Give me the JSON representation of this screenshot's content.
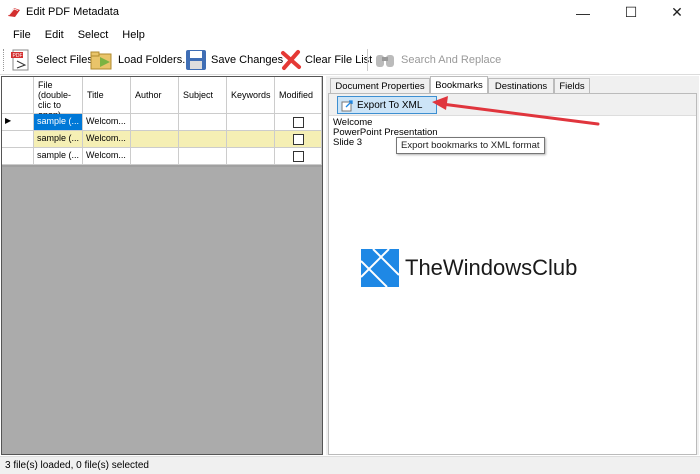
{
  "window": {
    "title": "Edit PDF Metadata",
    "minimize": "—",
    "maximize": "☐",
    "close": "✕"
  },
  "menu": [
    "File",
    "Edit",
    "Select",
    "Help"
  ],
  "toolbar": {
    "select_files": "Select Files",
    "load_folders": "Load Folders...",
    "save_changes": "Save Changes",
    "clear_file_list": "Clear File List",
    "search_replace": "Search And Replace"
  },
  "grid": {
    "headers": {
      "file": "File (double-clic to open)",
      "title": "Title",
      "author": "Author",
      "subject": "Subject",
      "keywords": "Keywords",
      "modified": "Modified"
    },
    "rows": [
      {
        "marker": "▶",
        "file": "sample (...",
        "title": "Welcom...",
        "author": "",
        "subject": "",
        "keywords": ""
      },
      {
        "marker": "",
        "file": "sample (...",
        "title": "Welcom...",
        "author": "",
        "subject": "",
        "keywords": ""
      },
      {
        "marker": "",
        "file": "sample (...",
        "title": "Welcom...",
        "author": "",
        "subject": "",
        "keywords": ""
      }
    ]
  },
  "tabs": {
    "document_properties": "Document Properties",
    "bookmarks": "Bookmarks",
    "destinations": "Destinations",
    "fields": "Fields"
  },
  "bookmarks": {
    "export_button": "Export To XML",
    "tooltip": "Export bookmarks to XML format",
    "lines": [
      "Welcome",
      "PowerPoint Presentation",
      "Slide 3"
    ]
  },
  "watermark": {
    "text": "TheWindowsClub"
  },
  "status": {
    "text": "3 file(s) loaded, 0 file(s) selected"
  },
  "colors": {
    "accent": "#0078d7",
    "selected_row": "#f5efb4",
    "arrow": "#e0353d",
    "logo_blue": "#1e88e5"
  }
}
